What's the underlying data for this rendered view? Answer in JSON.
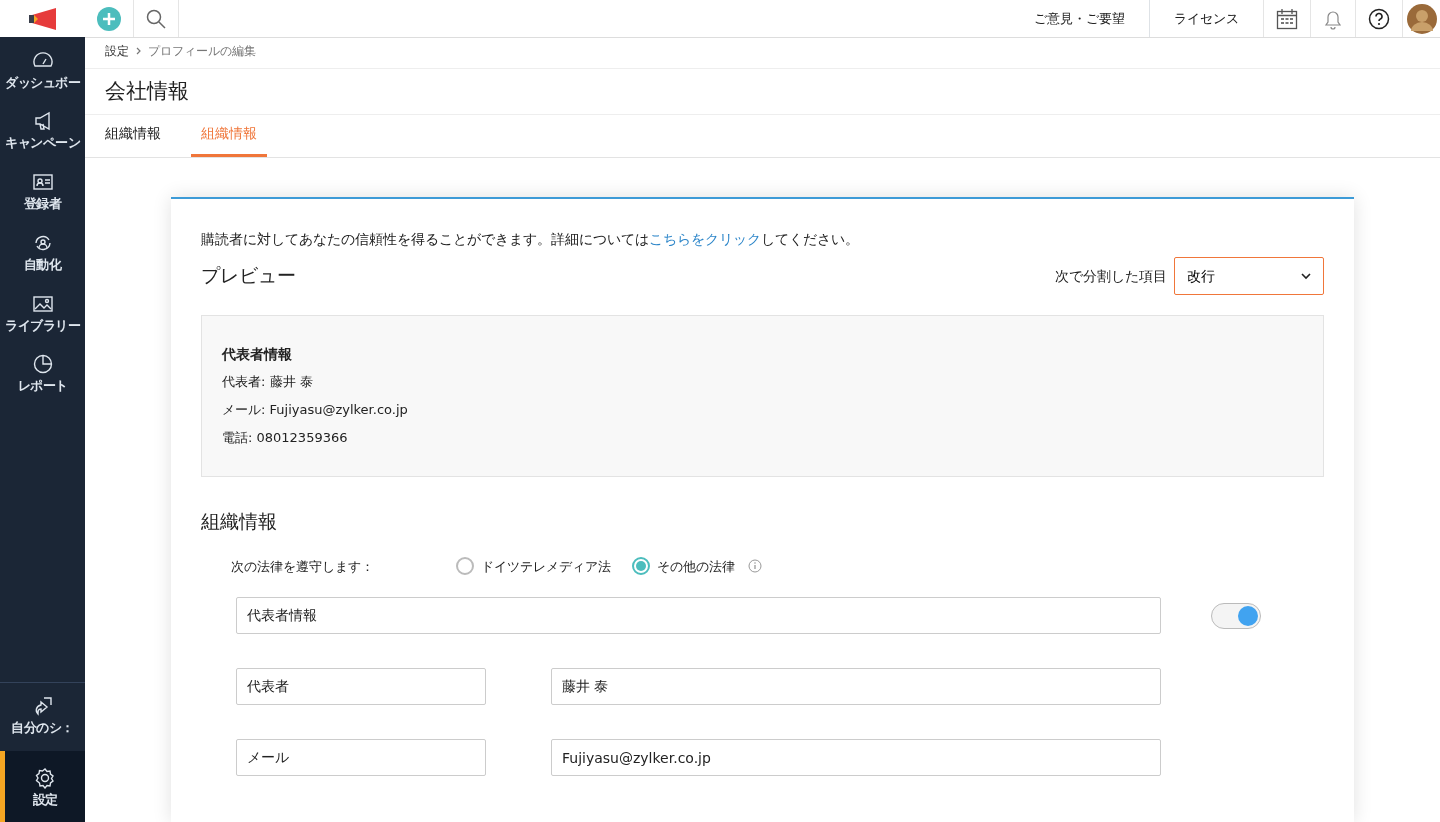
{
  "topbar": {
    "links": [
      "ご意見・ご要望",
      "ライセンス"
    ]
  },
  "sidebar": {
    "items": [
      {
        "label": "ダッシュボー",
        "selected": false
      },
      {
        "label": "キャンペーン",
        "selected": false
      },
      {
        "label": "登録者",
        "selected": false
      },
      {
        "label": "自動化",
        "selected": false
      },
      {
        "label": "ライブラリー",
        "selected": false
      },
      {
        "label": "レポート",
        "selected": false
      }
    ],
    "bottom_items": [
      {
        "label": "自分のシ：",
        "selected": false
      },
      {
        "label": "設定",
        "selected": true
      }
    ]
  },
  "breadcrumb": [
    "設定",
    "プロフィールの編集"
  ],
  "page_title": "会社情報",
  "tabs": [
    {
      "label": "組織情報",
      "selected": false
    },
    {
      "label": "組織情報",
      "selected": true
    }
  ],
  "card": {
    "intro": "購読者に対してあなたの信頼性を得ることができます。詳細については",
    "intro_link": "こちらをクリック",
    "intro_end": "してください。",
    "preview_title": "プレビュー",
    "separator_label": "次で分割した項目",
    "separator_value": "改行",
    "preview": {
      "heading": "代表者情報",
      "lines": [
        "代表者:  藤井 泰",
        "メール:  Fujiyasu@zylker.co.jp",
        "電話:  08012359366"
      ]
    },
    "section_title": "組織情報",
    "law_label": "次の法律を遵守します：",
    "law_options": [
      {
        "label": "ドイツテレメディア法",
        "selected": false
      },
      {
        "label": "その他の法律",
        "selected": true
      }
    ],
    "group_field": {
      "value": "代表者情報",
      "on": true
    },
    "rows": [
      {
        "label": "代表者",
        "value": "藤井 泰"
      },
      {
        "label": "メール",
        "value": "Fujiyasu@zylker.co.jp"
      }
    ]
  }
}
